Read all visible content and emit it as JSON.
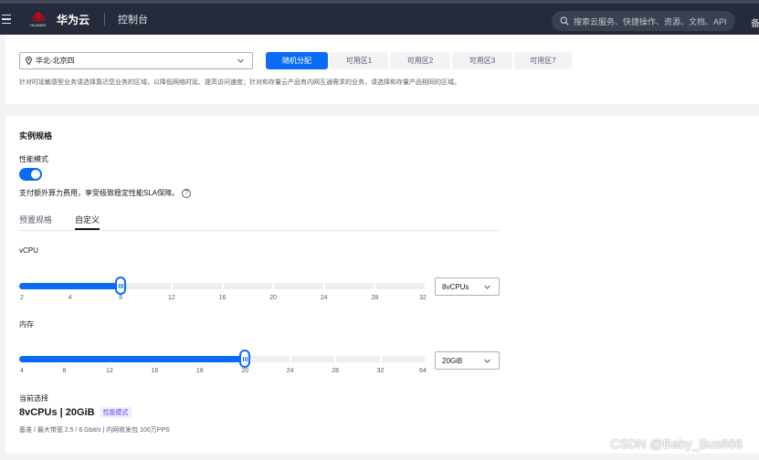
{
  "topbar": {
    "brand": "华为云",
    "logo_text": "HUAWEI",
    "console": "控制台",
    "search_placeholder": "搜索云服务、快捷操作、资源、文档、API",
    "right_cut": "备"
  },
  "region": {
    "selected": "华北-北京四",
    "az_buttons": [
      "随机分配",
      "可用区1",
      "可用区2",
      "可用区3",
      "可用区7"
    ],
    "active_az_index": 0,
    "tip": "针对时延敏感型业务请选择靠近您业务的区域，以降低网络时延、提高访问速度；针对和存量云产品有内网互通需求的业务，请选择和存量产品相同的区域。"
  },
  "spec": {
    "title": "实例规格",
    "perf_mode_label": "性能模式",
    "perf_mode_on": true,
    "perf_desc": "支付额外算力费用，享受极致稳定性能SLA保障。",
    "help": "?",
    "tabs": [
      "预置规格",
      "自定义"
    ],
    "active_tab": 1,
    "vcpu": {
      "label": "vCPU",
      "ticks": [
        "2",
        "4",
        "8",
        "12",
        "16",
        "20",
        "24",
        "28",
        "32"
      ],
      "selected_index": 2,
      "value": "8vCPUs"
    },
    "memory": {
      "label": "内存",
      "ticks": [
        "4",
        "8",
        "12",
        "16",
        "18",
        "20",
        "24",
        "28",
        "32",
        "64"
      ],
      "selected_index": 5,
      "value": "20GiB"
    },
    "current_label": "当前选择",
    "current_summary": "8vCPUs | 20GiB",
    "current_badge": "性能模式",
    "current_detail": "基准 / 最大带宽  2.5 / 6 Gbit/s  |  内网收发包  100万PPS"
  },
  "watermark": "CSDN @Baby_Bus666",
  "colors": {
    "accent": "#0a6cf5",
    "topbar": "#252b3a",
    "badge": "#5b4fe0"
  },
  "icons": [
    "menu-icon",
    "huawei-logo",
    "search-icon",
    "location-pin-icon",
    "chevron-down-icon",
    "help-icon"
  ]
}
